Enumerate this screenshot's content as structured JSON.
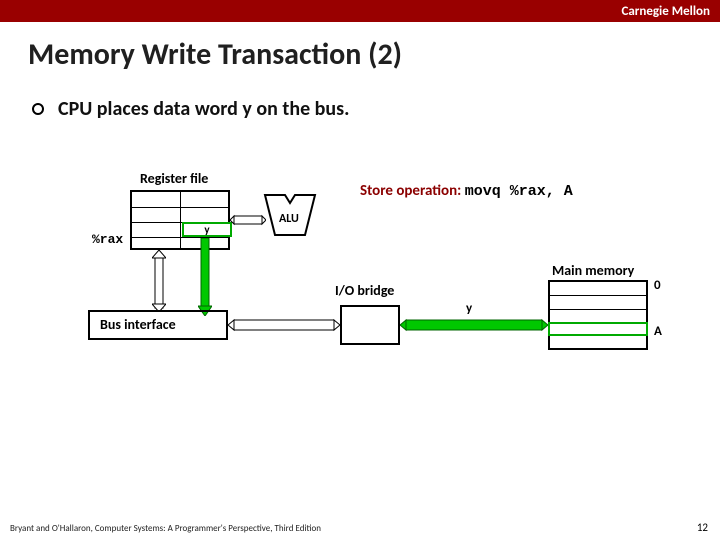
{
  "header": {
    "brand": "Carnegie Mellon"
  },
  "title": "Memory Write Transaction (2)",
  "bullet": "CPU places data word y on the bus.",
  "labels": {
    "register_file": "Register file",
    "rax": "%rax",
    "rax_value": "y",
    "alu": "ALU",
    "store_op_prefix": "Store operation:",
    "store_op_code": "movq %rax, A",
    "io_bridge": "I/O bridge",
    "bus_value": "y",
    "bus_interface": "Bus interface",
    "main_memory": "Main memory",
    "mem_top": "0",
    "mem_A": "A"
  },
  "footer": "Bryant and O'Hallaron, Computer Systems: A Programmer's Perspective, Third Edition",
  "page": "12"
}
